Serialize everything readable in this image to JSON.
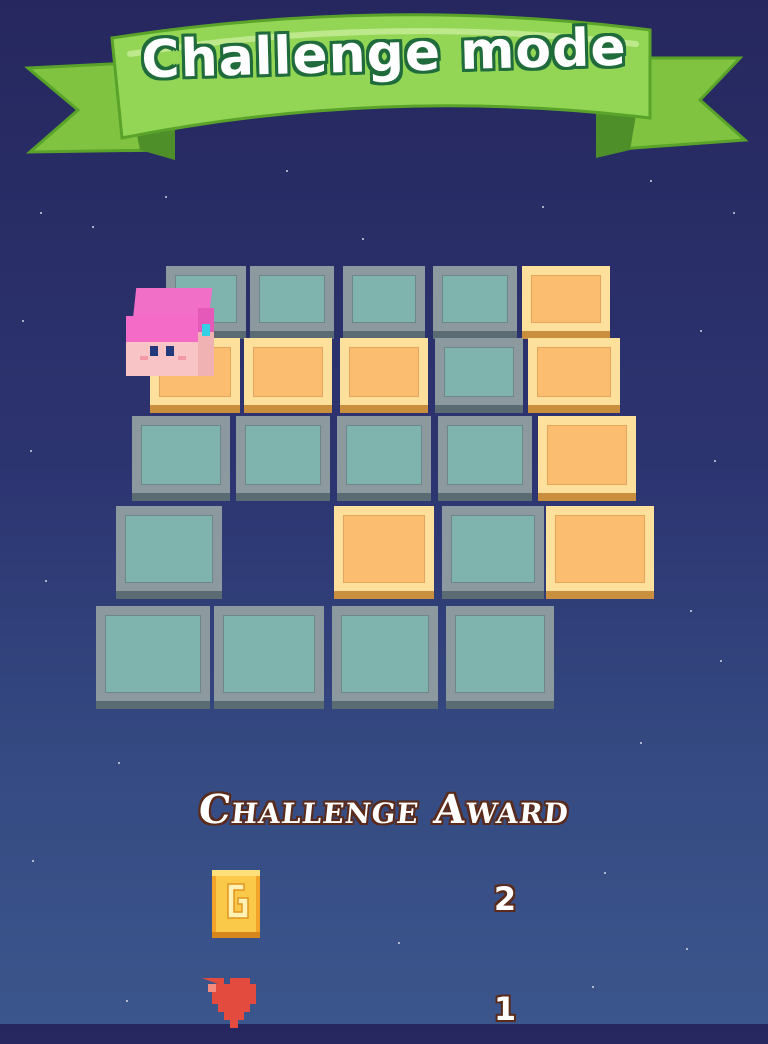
{
  "banner": {
    "title": "Challenge mode"
  },
  "board": {
    "rows": [
      [
        "teal",
        "teal",
        "teal",
        "teal",
        "orange"
      ],
      [
        "orange",
        "orange",
        "orange",
        "teal",
        "orange"
      ],
      [
        "teal",
        "teal",
        "teal",
        "teal",
        "orange"
      ],
      [
        "teal",
        null,
        "orange",
        "teal",
        "orange"
      ],
      [
        "teal",
        "teal",
        "teal",
        "teal",
        null
      ]
    ],
    "player": {
      "row": 1,
      "col": 0
    }
  },
  "award": {
    "title": "Challenge Award",
    "items": [
      {
        "icon": "gold-coin-icon",
        "count": "2"
      },
      {
        "icon": "heart-icon",
        "count": "1"
      }
    ]
  },
  "colors": {
    "banner_green": "#8fd34f",
    "tile_teal": "#7fb3ad",
    "tile_orange": "#fbbd6f",
    "player_pink": "#f26fc7"
  }
}
